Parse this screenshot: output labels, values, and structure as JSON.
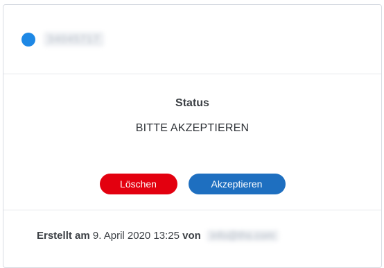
{
  "header": {
    "status_color": "#1e88e5",
    "id_value": "34045717"
  },
  "status": {
    "label": "Status",
    "value": "BITTE AKZEPTIEREN"
  },
  "actions": {
    "delete_label": "Löschen",
    "delete_color": "#e3000f",
    "accept_label": "Akzeptieren",
    "accept_color": "#1e6fc0"
  },
  "footer": {
    "created_prefix": "Erstellt am",
    "created_date": "9. April 2020 13:25",
    "by_prefix": "von",
    "author": "info@ths.com"
  }
}
